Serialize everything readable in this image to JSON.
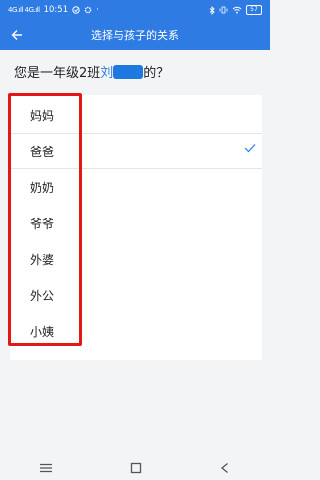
{
  "status_bar": {
    "signal": "4G.ıll 4G.ıll",
    "time": "10:51",
    "battery": "57"
  },
  "header": {
    "title": "选择与孩子的关系"
  },
  "question": {
    "prefix": "您是一年级2班",
    "name_visible": "刘",
    "suffix": "的？"
  },
  "relations": [
    {
      "label": "妈妈",
      "selected": false
    },
    {
      "label": "爸爸",
      "selected": true
    },
    {
      "label": "奶奶",
      "selected": false
    },
    {
      "label": "爷爷",
      "selected": false
    },
    {
      "label": "外婆",
      "selected": false
    },
    {
      "label": "外公",
      "selected": false
    },
    {
      "label": "小姨",
      "selected": false
    }
  ],
  "colors": {
    "brand": "#2e7be3",
    "highlight_border": "#e41717",
    "check": "#2e7be3"
  }
}
